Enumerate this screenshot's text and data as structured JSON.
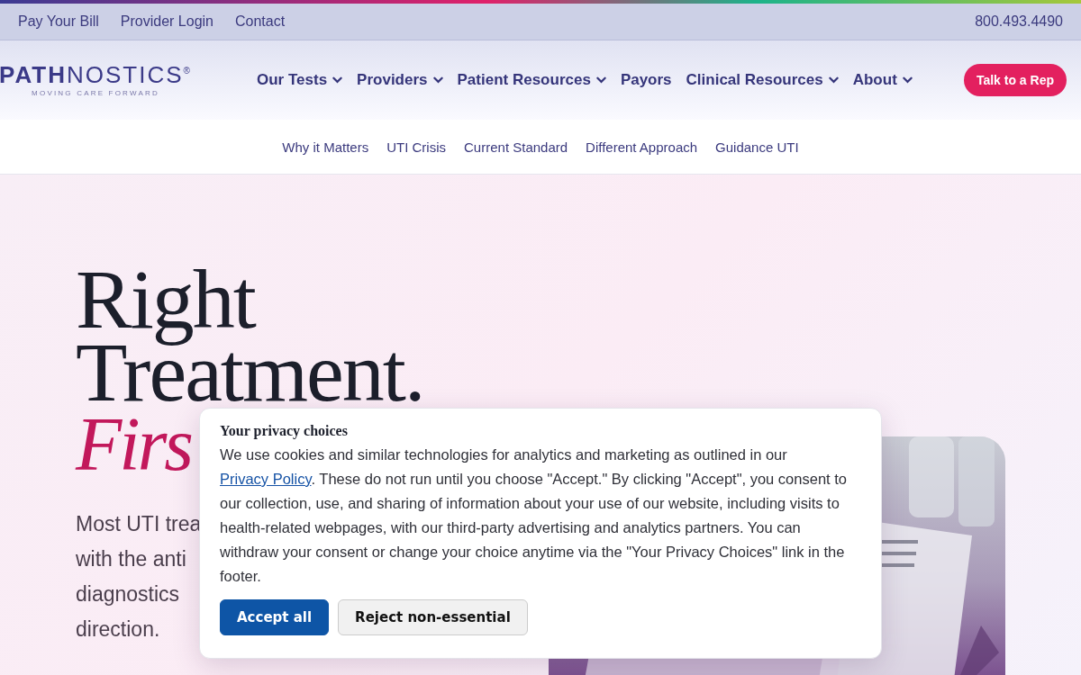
{
  "utility_bar": {
    "links": [
      "Pay Your Bill",
      "Provider Login",
      "Contact"
    ],
    "phone": "800.493.4490"
  },
  "header": {
    "logo": {
      "wordmark": "**PATH**NOSTICS$^{®}$",
      "tagline": "MOVING CARE FORWARD"
    },
    "nav": [
      {
        "label": "Our Tests",
        "has_menu": true
      },
      {
        "label": "Providers",
        "has_menu": true
      },
      {
        "label": "Patient Resources",
        "has_menu": true
      },
      {
        "label": "Payors",
        "has_menu": false
      },
      {
        "label": "Clinical Resources",
        "has_menu": true
      },
      {
        "label": "About",
        "has_menu": true
      }
    ],
    "cta": "Talk to a Rep"
  },
  "sub_nav": [
    "Why it Matters",
    "UTI Crisis",
    "Current Standard",
    "Different Approach",
    "Guidance UTI"
  ],
  "hero": {
    "heading_lines": [
      "Right",
      "Treatment."
    ],
    "heading_accent": "Firs",
    "body_lines": [
      "Most UTI trea",
      "with the anti",
      "diagnostics",
      "direction."
    ],
    "image": {
      "kind": "picture"
    }
  },
  "cookie_dialog": {
    "title": "Your privacy choices",
    "text_before": "We use cookies and similar technologies for analytics and marketing as outlined in our",
    "link": "Privacy Policy",
    "text_after": ". These do not run until you choose \"Accept.\" By clicking \"Accept\", you consent to our collection, use, and sharing of information about your use of our website, including visits to health-related webpages, with our third-party advertising and analytics partners. You can withdraw your consent or change your choice anytime via the \"Your Privacy Choices\" link in the footer.",
    "buttons": [
      {
        "label": "Accept all",
        "kind": "primary"
      },
      {
        "label": "Reject non-essential",
        "kind": "secondary"
      }
    ]
  }
}
